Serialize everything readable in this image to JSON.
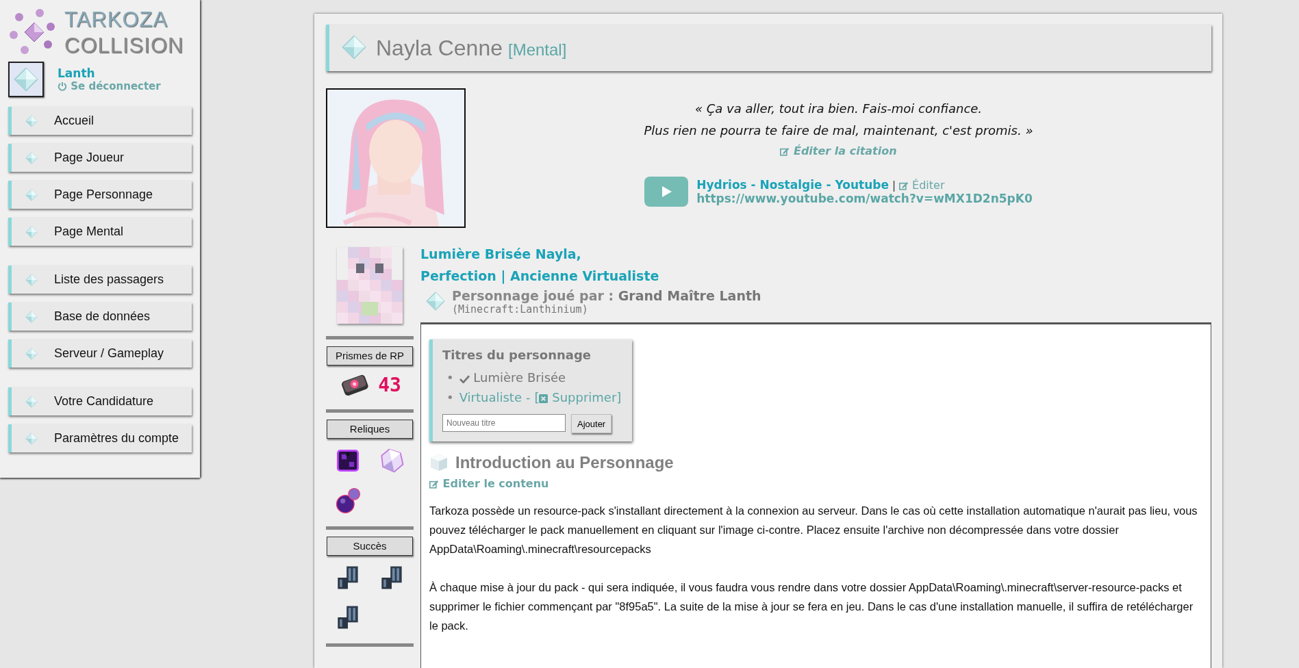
{
  "logo": {
    "line_1": "TARKOZA",
    "line_2": "COLLISION"
  },
  "user": {
    "name": "Lanth",
    "logout": "Se déconnecter"
  },
  "nav": {
    "groups": [
      [
        {
          "label": "Accueil"
        },
        {
          "label": "Page Joueur"
        },
        {
          "label": "Page Personnage"
        },
        {
          "label": "Page Mental"
        }
      ],
      [
        {
          "label": "Liste des passagers"
        },
        {
          "label": "Base de données"
        },
        {
          "label": "Serveur / Gameplay"
        }
      ],
      [
        {
          "label": "Votre Candidature"
        },
        {
          "label": "Paramètres du compte"
        }
      ]
    ]
  },
  "header": {
    "name": "Nayla Cenne",
    "tag": "[Mental]"
  },
  "quote": {
    "lines": [
      "« Ça va aller, tout ira bien. Fais-moi confiance.",
      "Plus rien ne pourra te faire de mal, maintenant, c'est promis. »"
    ],
    "edit": "Éditer la citation"
  },
  "music": {
    "title": "Hydrios - Nostalgie - Youtube",
    "separator": "|",
    "edit": "Éditer",
    "url": "https://www.youtube.com/watch?v=wMX1D2n5pK0"
  },
  "character": {
    "title_lines": [
      "Lumière Brisée Nayla,",
      "Perfection | Ancienne Virtualiste"
    ],
    "played_by": "Personnage joué par :",
    "player": "Grand Maître Lanth",
    "account": "(Minecraft:Lanthinium)"
  },
  "side_sections": [
    {
      "label": "Prismes de RP",
      "kind": "count",
      "count": "43"
    },
    {
      "label": "Reliques",
      "kind": "icons",
      "items": [
        {
          "kind": "cube"
        },
        {
          "kind": "crystal"
        },
        {
          "kind": "orb"
        }
      ]
    },
    {
      "label": "Succès",
      "kind": "icons",
      "items": [
        {
          "kind": "blocks"
        },
        {
          "kind": "blocks"
        },
        {
          "kind": "blocks"
        }
      ]
    }
  ],
  "titles_box": {
    "heading": "Titres du personnage",
    "items": [
      {
        "marker": "•",
        "label": "Lumière Brisée",
        "current": true
      },
      {
        "marker": "•",
        "label": "Virtualiste",
        "current": false,
        "separator": "-",
        "action_open": "[",
        "action": "Supprimer",
        "action_close": "]"
      }
    ],
    "placeholder": "Nouveau titre",
    "button": "Ajouter"
  },
  "intro": {
    "heading": "Introduction au Personnage",
    "edit": "Editer le contenu",
    "paragraphs": [
      "Tarkoza possède un resource-pack s'installant directement à la connexion au serveur. Dans le cas où cette installation automatique n'aurait pas lieu, vous pouvez télécharger le pack manuellement en cliquant sur l'image ci-contre. Placez ensuite l'archive non décompressée dans votre dossier AppData\\Roaming\\.minecraft\\resourcepacks",
      "À chaque mise à jour du pack - qui sera indiquée, il vous faudra vous rendre dans votre dossier AppData\\Roaming\\.minecraft\\server-resource-packs et supprimer le fichier commençant par \"8f95a5\". La suite de la mise à jour se fera en jeu. Dans le cas d'une installation manuelle, il suffira de retélécharger le pack."
    ]
  }
}
